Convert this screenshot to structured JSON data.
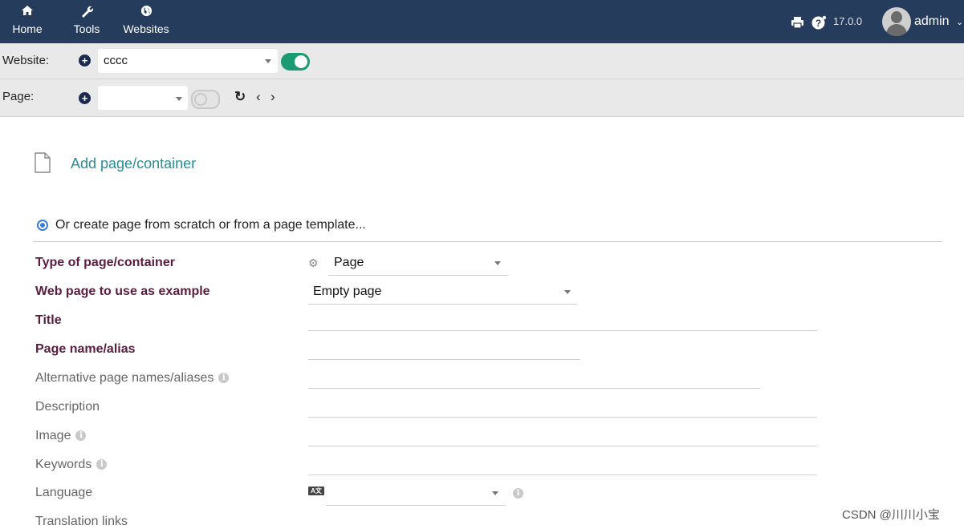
{
  "topnav": {
    "items": [
      {
        "label": "Home",
        "icon": "home-icon"
      },
      {
        "label": "Tools",
        "icon": "wrench-icon"
      },
      {
        "label": "Websites",
        "icon": "globe-icon"
      }
    ],
    "version": "17.0.0",
    "user": "admin"
  },
  "website_bar": {
    "label": "Website:",
    "selected": "cccc",
    "toggle_on": true
  },
  "page_bar": {
    "label": "Page:",
    "selected": "",
    "toggle_on": false
  },
  "main": {
    "add_link": "Add page/container",
    "radio_label": "Or create page from scratch or from a page template...",
    "fields": {
      "type_label": "Type of page/container",
      "type_value": "Page",
      "example_label": "Web page to use as example",
      "example_value": "Empty page",
      "title_label": "Title",
      "alias_label": "Page name/alias",
      "alt_alias_label": "Alternative page names/aliases",
      "description_label": "Description",
      "image_label": "Image",
      "keywords_label": "Keywords",
      "language_label": "Language",
      "language_value": "",
      "translation_label": "Translation links"
    }
  },
  "watermark": "CSDN @川川小宝",
  "colors": {
    "nav_bg": "#263c5c",
    "toggle_on": "#1b9b72",
    "link": "#2a8d96",
    "required_label": "#5a1c3f"
  }
}
